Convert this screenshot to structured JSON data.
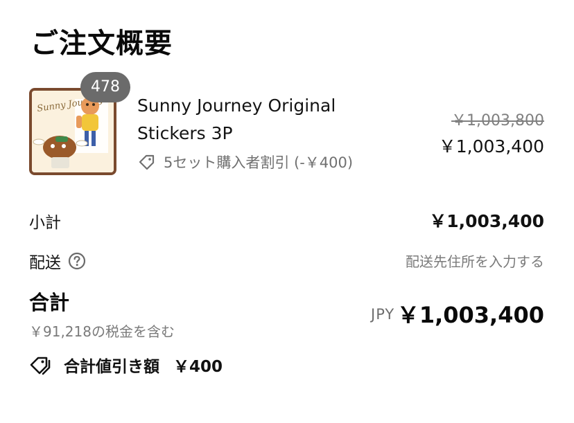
{
  "summary": {
    "title": "ご注文概要"
  },
  "line_item": {
    "quantity": "478",
    "name": "Sunny Journey Original Stickers 3P",
    "discount_label": "5セット購入者割引 (-￥400)",
    "price_original": "￥1,003,800",
    "price_current": "￥1,003,400",
    "thumbnail_text": "Sunny Journey",
    "icons": {
      "discount": "tag-icon"
    }
  },
  "subtotal": {
    "label": "小計",
    "value": "￥1,003,400"
  },
  "shipping": {
    "label": "配送",
    "value": "配送先住所を入力する",
    "icon": "help-circle-icon"
  },
  "total": {
    "label": "合計",
    "tax_note": "￥91,218の税金を含む",
    "currency": "JPY",
    "value": "￥1,003,400"
  },
  "savings": {
    "label": "合計値引き額",
    "value": "￥400",
    "icon": "tag-icon"
  },
  "colors": {
    "badge": "#6b6b6b",
    "thumbnail_border": "#7a4a2e",
    "muted_text": "#7a7a7a"
  }
}
